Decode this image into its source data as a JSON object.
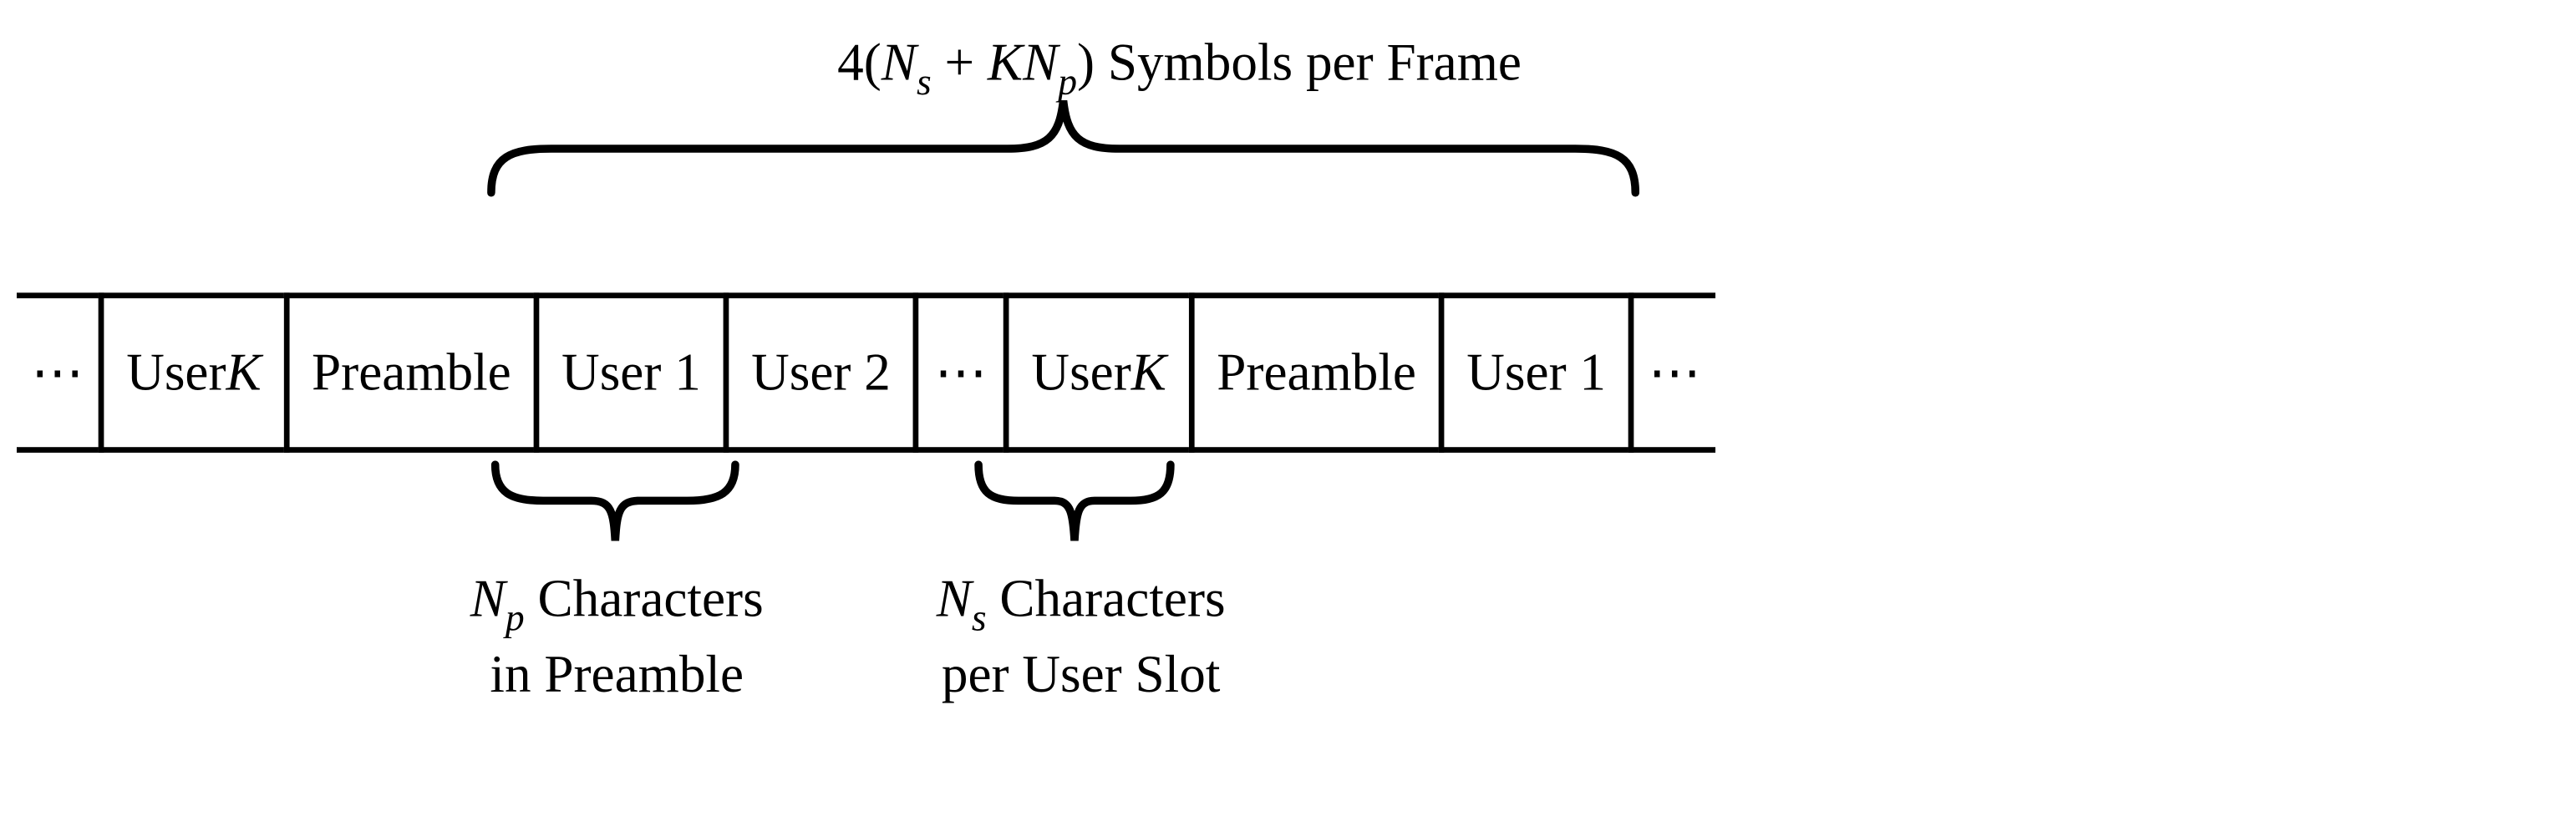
{
  "top_label": {
    "prefix": "4(",
    "n": "N",
    "sub_s": "s",
    "plus": " + ",
    "k": "K",
    "n2": "N",
    "sub_p": "p",
    "suffix": ") Symbols per Frame"
  },
  "cells": {
    "ell1": "⋯",
    "userk1_pre": "User ",
    "userk1_var": "K",
    "preamble1": "Preamble",
    "user1_1": "User 1",
    "user2": "User 2",
    "ell2": "⋯",
    "userk2_pre": "User ",
    "userk2_var": "K",
    "preamble2": "Preamble",
    "user1_2": "User 1",
    "ell3": "⋯"
  },
  "bottom_label_1": {
    "n": "N",
    "sub_p": "p",
    "line1_rest": " Characters",
    "line2": "in Preamble"
  },
  "bottom_label_2": {
    "n": "N",
    "sub_s": "s",
    "line1_rest": " Characters",
    "line2": "per User Slot"
  }
}
